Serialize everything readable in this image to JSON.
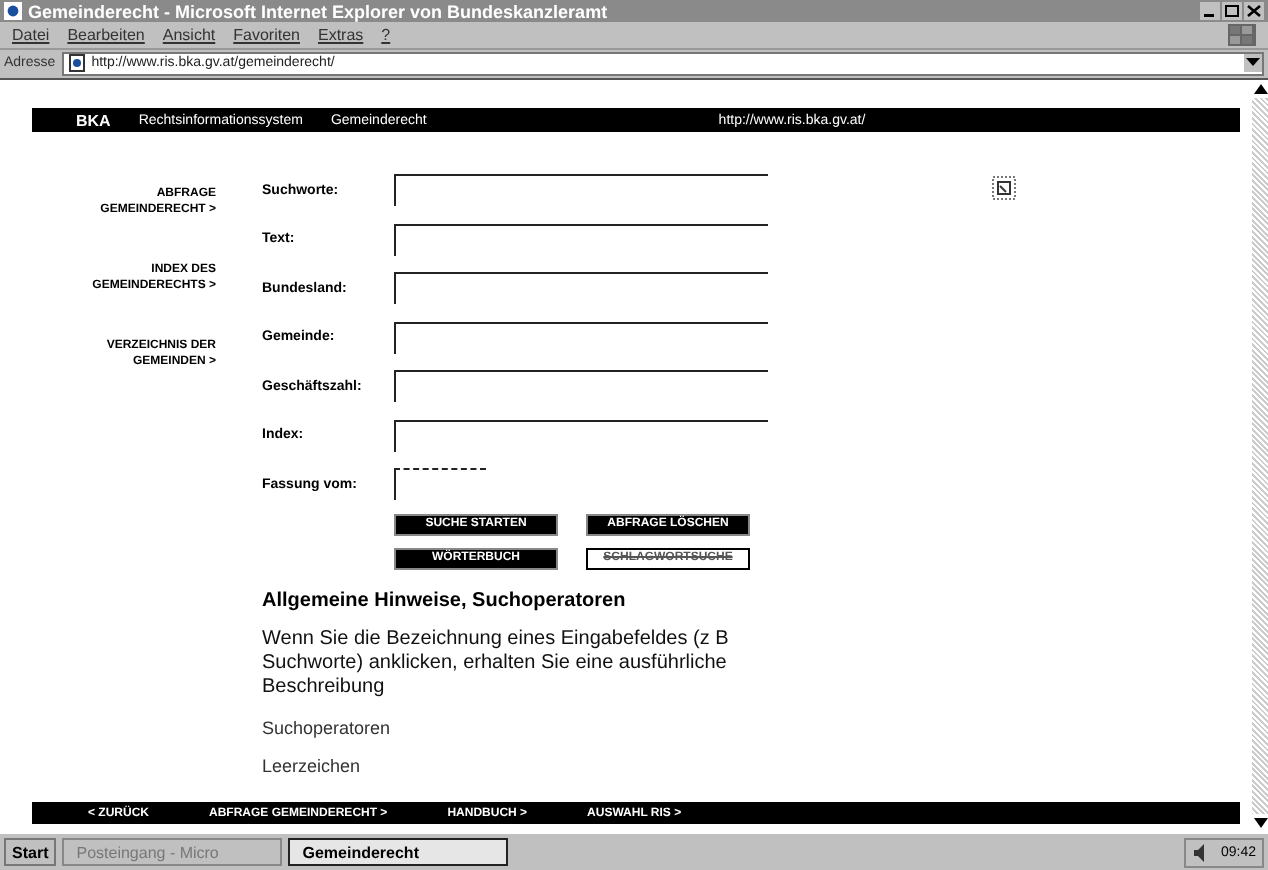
{
  "window": {
    "title": "Gemeinderecht - Microsoft Internet Explorer von Bundeskanzleramt"
  },
  "menu": [
    "Datei",
    "Bearbeiten",
    "Ansicht",
    "Favoriten",
    "Extras",
    "?"
  ],
  "address_bar": {
    "label": "Adresse",
    "value": "http://www.ris.bka.gv.at/gemeinderecht/"
  },
  "header": {
    "logo": "BKA",
    "site": "Rechtsinformationssystem",
    "section": "Gemeinderecht",
    "url": "http://www.ris.bka.gv.at/"
  },
  "sidebar": {
    "items": [
      "ABFRAGE GEMEINDERECHT >",
      "INDEX DES GEMEINDERECHTS >",
      "VERZEICHNIS DER GEMEINDEN >"
    ]
  },
  "form": {
    "fields": [
      {
        "label": "Suchworte:",
        "kind": "wide"
      },
      {
        "label": "Text:",
        "kind": "wide"
      },
      {
        "label": "Bundesland:",
        "kind": "wide"
      },
      {
        "label": "Gemeinde:",
        "kind": "wide"
      },
      {
        "label": "Geschäftszahl:",
        "kind": "wide"
      },
      {
        "label": "Index:",
        "kind": "wide"
      },
      {
        "label": "Fassung vom:",
        "kind": "date"
      }
    ],
    "buttons": [
      {
        "label": "SUCHE STARTEN",
        "disabled": false
      },
      {
        "label": "ABFRAGE LÖSCHEN",
        "disabled": false
      },
      {
        "label": "WÖRTERBUCH",
        "disabled": false
      },
      {
        "label": "SCHLAGWORTSUCHE",
        "disabled": true
      }
    ]
  },
  "help": {
    "title": "Allgemeine Hinweise, Suchoperatoren",
    "text": "Wenn Sie die Bezeichnung eines Eingabefeldes (z B Suchworte) anklicken, erhalten Sie eine ausführliche Beschreibung",
    "links": [
      "Suchoperatoren",
      "Leerzeichen"
    ]
  },
  "footer": [
    "< ZURÜCK",
    "ABFRAGE GEMEINDERECHT >",
    "HANDBUCH >",
    "AUSWAHL RIS >"
  ],
  "taskbar": {
    "start": "Start",
    "tasks": [
      {
        "label": "Posteingang - Micro",
        "selected": false
      },
      {
        "label": "Gemeinderecht",
        "selected": true
      }
    ],
    "clock": "09:42"
  }
}
